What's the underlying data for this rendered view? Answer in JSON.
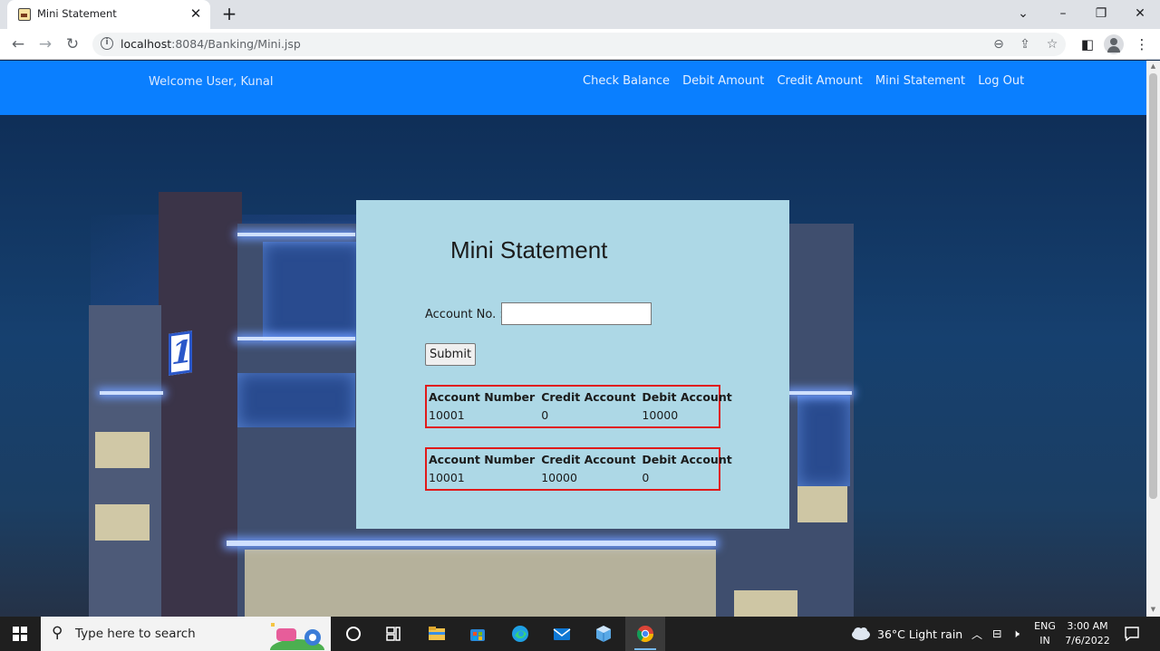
{
  "browser": {
    "tab_title": "Mini Statement",
    "tab_close": "✕",
    "new_tab": "+",
    "url_host": "localhost",
    "url_rest": ":8084/Banking/Mini.jsp",
    "icons": [
      "back-icon",
      "forward-icon",
      "reload-icon",
      "info-icon",
      "zoom-icon",
      "share-icon",
      "bookmark-star-icon",
      "side-panel-icon",
      "profile-icon",
      "menu-icon",
      "minimize-icon",
      "restore-icon",
      "close-icon",
      "tab-search-icon"
    ]
  },
  "header": {
    "welcome": "Welcome User, Kunal",
    "nav": [
      "Check Balance",
      "Debit Amount",
      "Credit Amount",
      "Mini Statement",
      "Log Out"
    ],
    "background_color": "#0a7fff"
  },
  "form": {
    "title": "Mini Statement",
    "account_label": "Account No. :",
    "account_value": "",
    "submit_label": "Submit",
    "panel_color": "#add8e6"
  },
  "statements": [
    {
      "headers": [
        "Account Number",
        "Credit Account",
        "Debit Account"
      ],
      "row": [
        "10001",
        "0",
        "10000"
      ]
    },
    {
      "headers": [
        "Account Number",
        "Credit Account",
        "Debit Account"
      ],
      "row": [
        "10001",
        "10000",
        "0"
      ]
    }
  ],
  "highlight_color": "#e01a1a",
  "taskbar": {
    "search_placeholder": "Type here to search",
    "weather": "36°C  Light rain",
    "lang_top": "ENG",
    "lang_bottom": "IN",
    "time": "3:00 AM",
    "date": "7/6/2022"
  }
}
